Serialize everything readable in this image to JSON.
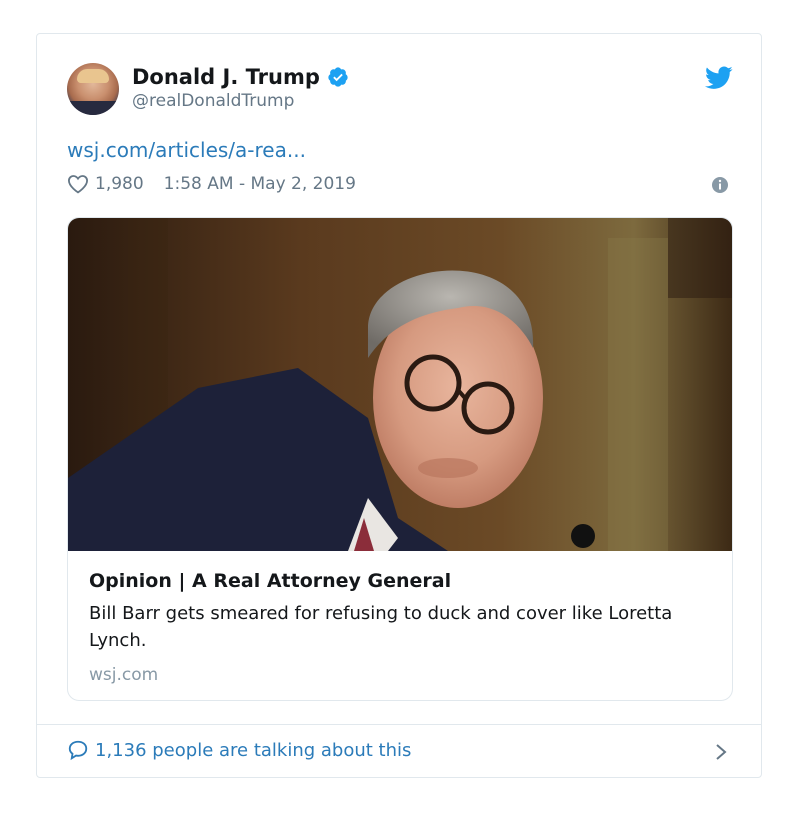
{
  "tweet": {
    "author_name": "Donald J. Trump",
    "handle": "@realDonaldTrump",
    "link_text": "wsj.com/articles/a-rea...",
    "likes": "1,980",
    "timestamp": "1:58 AM - May 2, 2019"
  },
  "media_card": {
    "title": "Opinion | A Real Attorney General",
    "description": "Bill Barr gets smeared for refusing to duck and cover like Loretta Lynch.",
    "domain": "wsj.com"
  },
  "footer": {
    "talking_text": "1,136 people are talking about this"
  },
  "colors": {
    "link_blue": "#2b7bb9",
    "twitter_blue": "#1da1f2",
    "muted_gray": "#657786",
    "border": "#e1e8ed"
  },
  "icons": [
    "verified-badge-icon",
    "twitter-bird-icon",
    "heart-icon",
    "info-icon",
    "speech-bubble-icon",
    "chevron-right-icon"
  ]
}
